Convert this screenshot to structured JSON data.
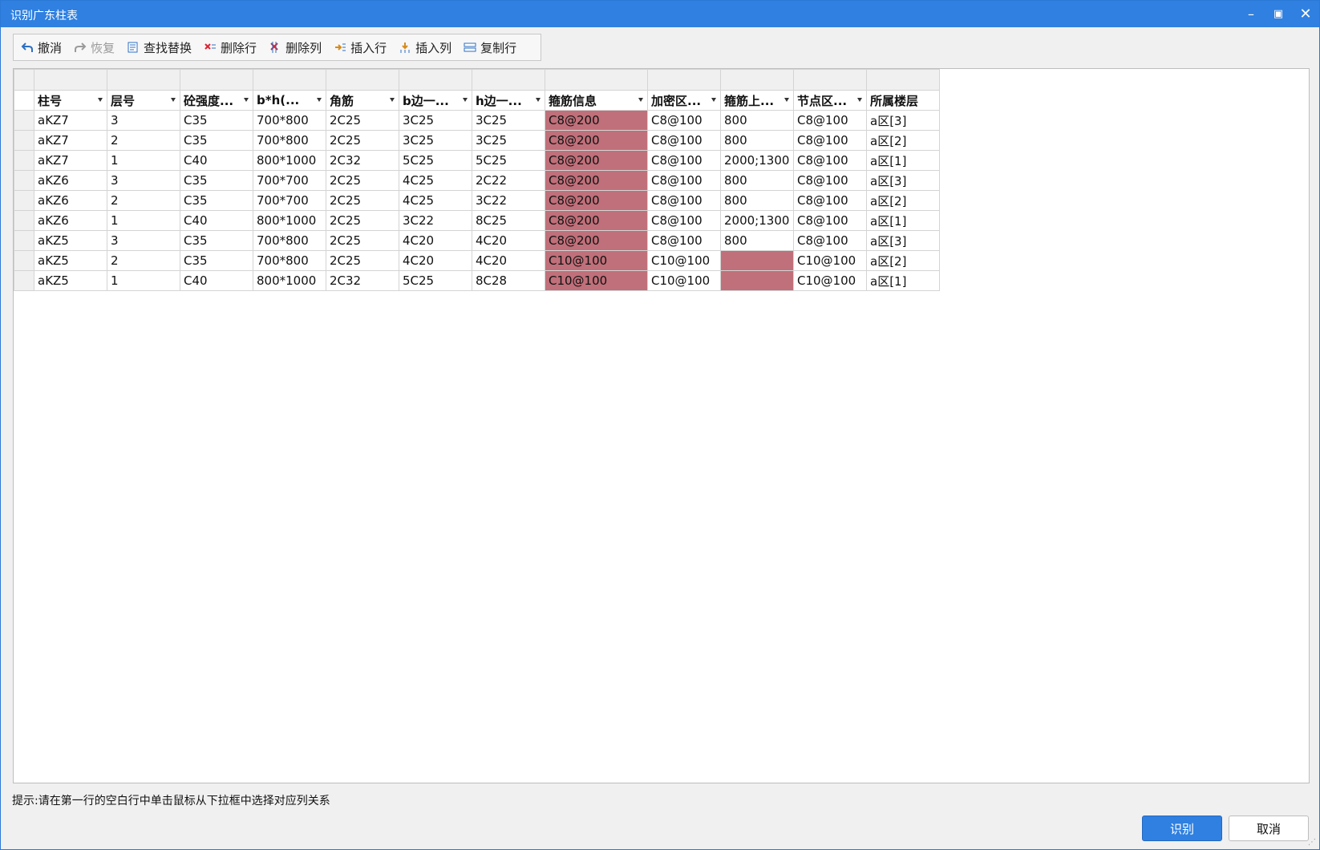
{
  "window": {
    "title": "识别广东柱表",
    "minimize_icon": "minimize-icon",
    "maximize_icon": "maximize-icon",
    "close_icon": "close-icon"
  },
  "toolbar": {
    "undo": "撤消",
    "redo": "恢复",
    "find_replace": "查找替换",
    "delete_row": "删除行",
    "delete_col": "删除列",
    "insert_row": "插入行",
    "insert_col": "插入列",
    "copy_row": "复制行"
  },
  "table": {
    "headers": [
      "柱号",
      "层号",
      "砼强度...",
      "b*h(...",
      "角筋",
      "b边一...",
      "h边一...",
      "箍筋信息",
      "加密区...",
      "箍筋上...",
      "节点区...",
      "所属楼层"
    ],
    "rows": [
      [
        "aKZ7",
        "3",
        "C35",
        "700*800",
        "2C25",
        "3C25",
        "3C25",
        "C8@200",
        "C8@100",
        "800",
        "C8@100",
        "a区[3]"
      ],
      [
        "aKZ7",
        "2",
        "C35",
        "700*800",
        "2C25",
        "3C25",
        "3C25",
        "C8@200",
        "C8@100",
        "800",
        "C8@100",
        "a区[2]"
      ],
      [
        "aKZ7",
        "1",
        "C40",
        "800*1000",
        "2C32",
        "5C25",
        "5C25",
        "C8@200",
        "C8@100",
        "2000;1300",
        "C8@100",
        "a区[1]"
      ],
      [
        "aKZ6",
        "3",
        "C35",
        "700*700",
        "2C25",
        "4C25",
        "2C22",
        "C8@200",
        "C8@100",
        "800",
        "C8@100",
        "a区[3]"
      ],
      [
        "aKZ6",
        "2",
        "C35",
        "700*700",
        "2C25",
        "4C25",
        "3C22",
        "C8@200",
        "C8@100",
        "800",
        "C8@100",
        "a区[2]"
      ],
      [
        "aKZ6",
        "1",
        "C40",
        "800*1000",
        "2C25",
        "3C22",
        "8C25",
        "C8@200",
        "C8@100",
        "2000;1300",
        "C8@100",
        "a区[1]"
      ],
      [
        "aKZ5",
        "3",
        "C35",
        "700*800",
        "2C25",
        "4C20",
        "4C20",
        "C8@200",
        "C8@100",
        "800",
        "C8@100",
        "a区[3]"
      ],
      [
        "aKZ5",
        "2",
        "C35",
        "700*800",
        "2C25",
        "4C20",
        "4C20",
        "C10@100",
        "C10@100",
        "",
        "C10@100",
        "a区[2]"
      ],
      [
        "aKZ5",
        "1",
        "C40",
        "800*1000",
        "2C32",
        "5C25",
        "8C28",
        "C10@100",
        "C10@100",
        "",
        "C10@100",
        "a区[1]"
      ]
    ],
    "highlight_color": "#c0707a"
  },
  "hint": "提示:请在第一行的空白行中单击鼠标从下拉框中选择对应列关系",
  "buttons": {
    "recognize": "识别",
    "cancel": "取消"
  },
  "colors": {
    "accent": "#2f80e0"
  }
}
